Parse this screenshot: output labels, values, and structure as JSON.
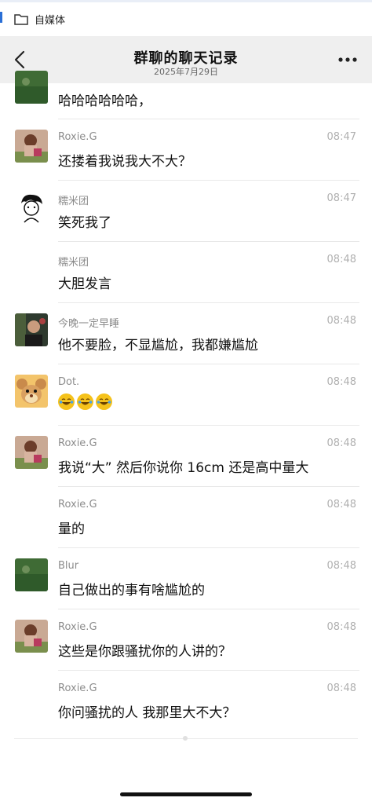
{
  "topbar": {
    "folder_label": "自媒体"
  },
  "navbar": {
    "title": "群聊的聊天记录",
    "subtitle": "2025年7月29日"
  },
  "messages": [
    {
      "avatar": "green-field-avatar",
      "sender": "",
      "time": "",
      "text": "哈哈哈哈哈哈，"
    },
    {
      "avatar": "roxie-avatar",
      "sender": "Roxie.G",
      "time": "08:47",
      "text": "还搂着我说我大不大？"
    },
    {
      "avatar": "sketch-boy-avatar",
      "sender": "糯米团",
      "time": "08:47",
      "text": "笑死我了"
    },
    {
      "avatar": "",
      "sender": "糯米团",
      "time": "08:48",
      "text": "大胆发言"
    },
    {
      "avatar": "man-photo-avatar",
      "sender": "今晚一定早睡",
      "time": "08:48",
      "text": "他不要脸，不显尴尬，我都嫌尴尬"
    },
    {
      "avatar": "cartoon-mouse-avatar",
      "sender": "Dot.",
      "time": "08:48",
      "text": "",
      "emojis": [
        "laughing-crying-emoji",
        "laughing-crying-emoji",
        "laughing-crying-emoji"
      ]
    },
    {
      "avatar": "roxie-avatar",
      "sender": "Roxie.G",
      "time": "08:48",
      "text": "我说“大” 然后你说你 16cm 还是高中量大"
    },
    {
      "avatar": "",
      "sender": "Roxie.G",
      "time": "08:48",
      "text": "量的"
    },
    {
      "avatar": "green-field-avatar",
      "sender": "Blur",
      "time": "08:48",
      "text": "自己做出的事有啥尴尬的"
    },
    {
      "avatar": "roxie-avatar",
      "sender": "Roxie.G",
      "time": "08:48",
      "text": "这些是你跟骚扰你的人讲的？"
    },
    {
      "avatar": "",
      "sender": "Roxie.G",
      "time": "08:48",
      "text": "你问骚扰的人 我那里大不大？"
    }
  ],
  "colors": {
    "navbar_bg": "#efefef",
    "emoji_yellow": "#f5c21b",
    "time_gray": "#b0b0b0"
  }
}
